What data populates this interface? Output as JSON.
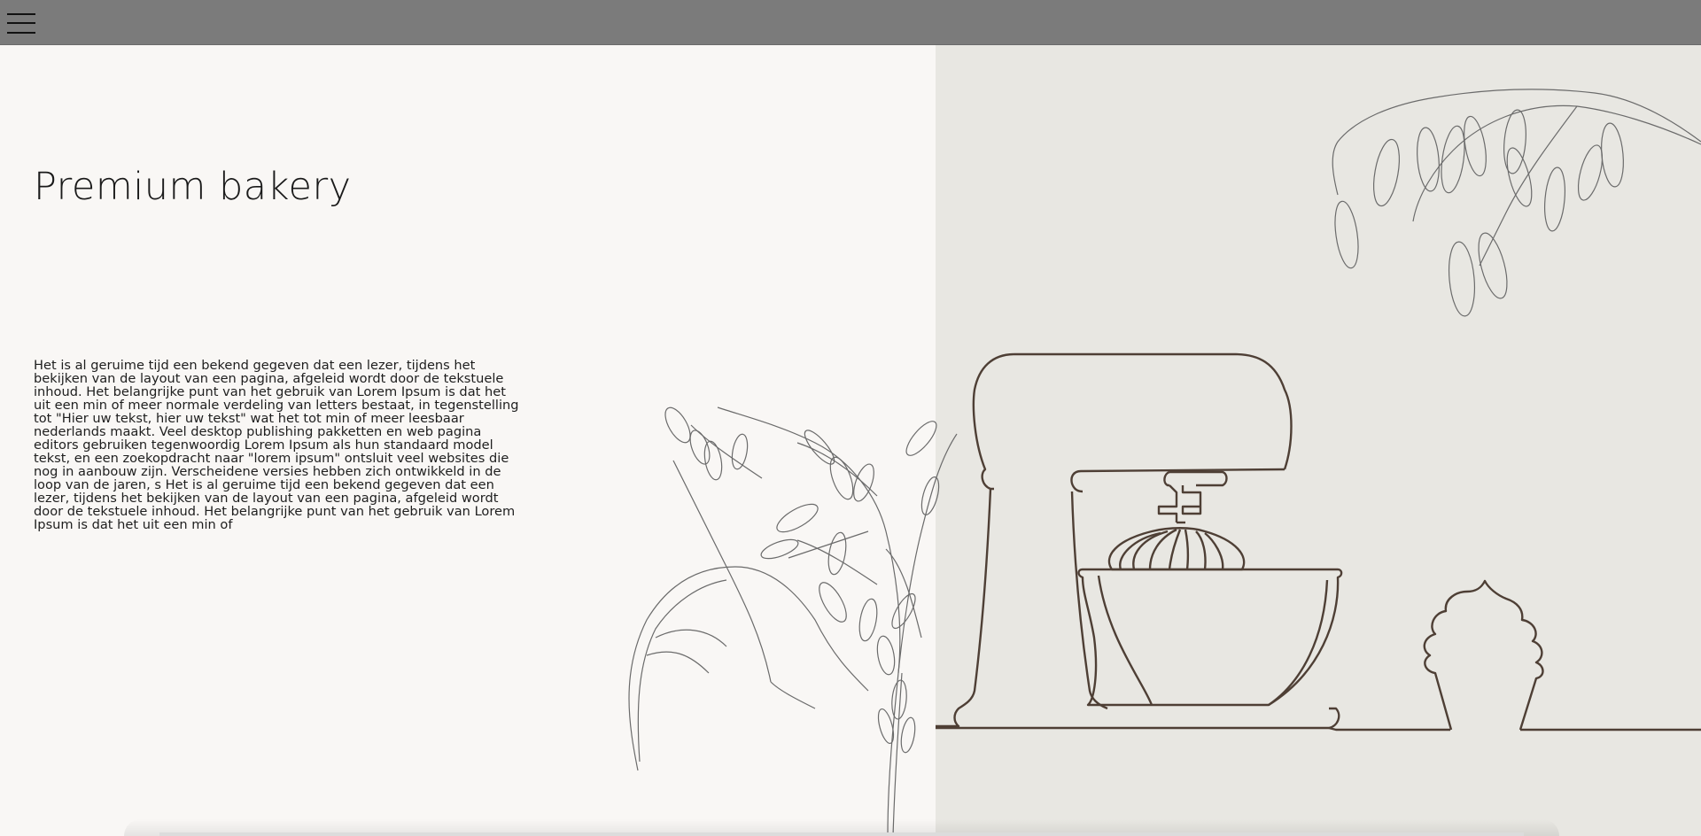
{
  "header": {
    "menu_icon": "hamburger-menu-icon",
    "background": "#7b7b7b"
  },
  "hero": {
    "title": "Premium bakery",
    "body": "Het is al geruime tijd een bekend gegeven dat een lezer, tijdens het bekijken van de layout van een pagina, afgeleid wordt door de tekstuele inhoud. Het belangrijke punt van het gebruik van Lorem Ipsum is dat het uit een min of meer normale verdeling van letters bestaat, in tegenstelling tot \"Hier uw tekst, hier uw tekst\" wat het tot min of meer leesbaar nederlands maakt. Veel desktop publishing pakketten en web pagina editors gebruiken tegenwoordig Lorem Ipsum als hun standaard model tekst, en een zoekopdracht naar \"lorem ipsum\" ontsluit veel websites die nog in aanbouw zijn. Verscheidene versies hebben zich ontwikkeld in de loop van de jaren, s Het is al geruime tijd een bekend gegeven dat een lezer, tijdens het bekijken van de layout van een pagina, afgeleid wordt door de tekstuele inhoud. Het belangrijke punt van het gebruik van Lorem Ipsum is dat het uit een min of"
  },
  "illustrations": {
    "mixer": "stand-mixer-illustration",
    "cupcake": "cupcake-illustration",
    "oat_left": "oat-plant-illustration",
    "oat_right": "oat-branch-illustration"
  },
  "colors": {
    "left_bg": "#f9f7f5",
    "right_bg": "#e8e7e2",
    "line_brown": "#4e3f35",
    "sketch_gray": "#6b6b6b"
  }
}
